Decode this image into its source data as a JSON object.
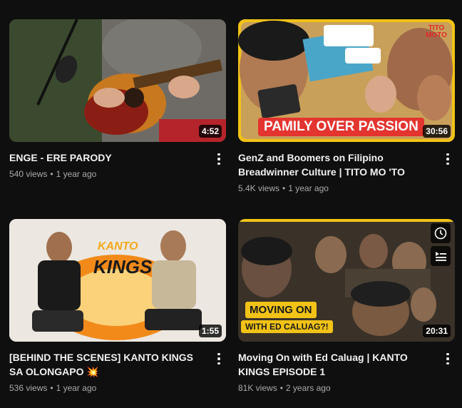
{
  "videos": [
    {
      "title": "ENGE - ERE PARODY",
      "views": "540 views",
      "age": "1 year ago",
      "duration": "4:52"
    },
    {
      "title": "GenZ and Boomers on Filipino Breadwinner Culture | TITO MO 'TO",
      "views": "5.4K views",
      "age": "1 year ago",
      "duration": "30:56",
      "thumb_text": "PAMILY OVER PASSION",
      "thumb_logo": "TITO MOTO"
    },
    {
      "title": "[BEHIND THE SCENES] KANTO KINGS SA OLONGAPO 💥",
      "views": "536 views",
      "age": "1 year ago",
      "duration": "1:55",
      "thumb_text_line1": "KANTO",
      "thumb_text_line2": "KINGS"
    },
    {
      "title": "Moving On with Ed Caluag | KANTO KINGS EPISODE 1",
      "views": "81K views",
      "age": "2 years ago",
      "duration": "20:31",
      "thumb_text_line1": "MOVING ON",
      "thumb_text_line2": "WITH ED CALUAG?!"
    }
  ],
  "separator": "•",
  "icons": {
    "more": "more-vert-icon",
    "watch_later": "clock-icon",
    "add_queue": "add-to-queue-icon"
  }
}
